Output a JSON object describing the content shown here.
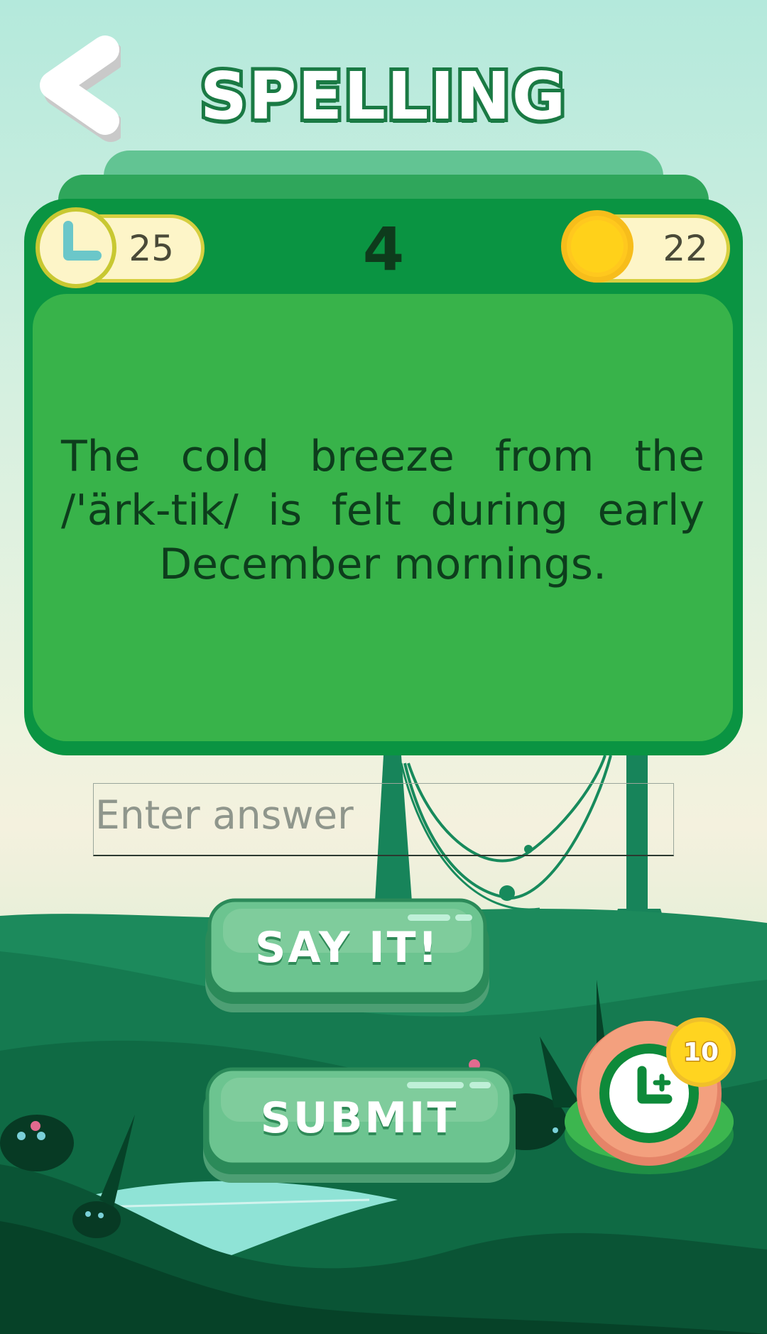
{
  "header": {
    "title": "SPELLING"
  },
  "game": {
    "timer_value": "25",
    "question_number": "4",
    "coins": "22",
    "prompt": "The cold breeze from the /'ärk-tik/ is felt during early December mornings."
  },
  "answer": {
    "placeholder": "Enter answer",
    "value": ""
  },
  "buttons": {
    "say_it": "SAY IT!",
    "submit": "SUBMIT",
    "bonus_time_badge": "10"
  },
  "colors": {
    "card_dark": "#0a9442",
    "card_light": "#38b34a",
    "title_outline": "#1a7a44",
    "button_face": "#6cc490",
    "coin": "#ffd11a"
  },
  "icons": {
    "back": "chevron-left-icon",
    "timer": "clock-icon",
    "coin": "coin-icon",
    "bonus": "clock-plus-icon"
  }
}
